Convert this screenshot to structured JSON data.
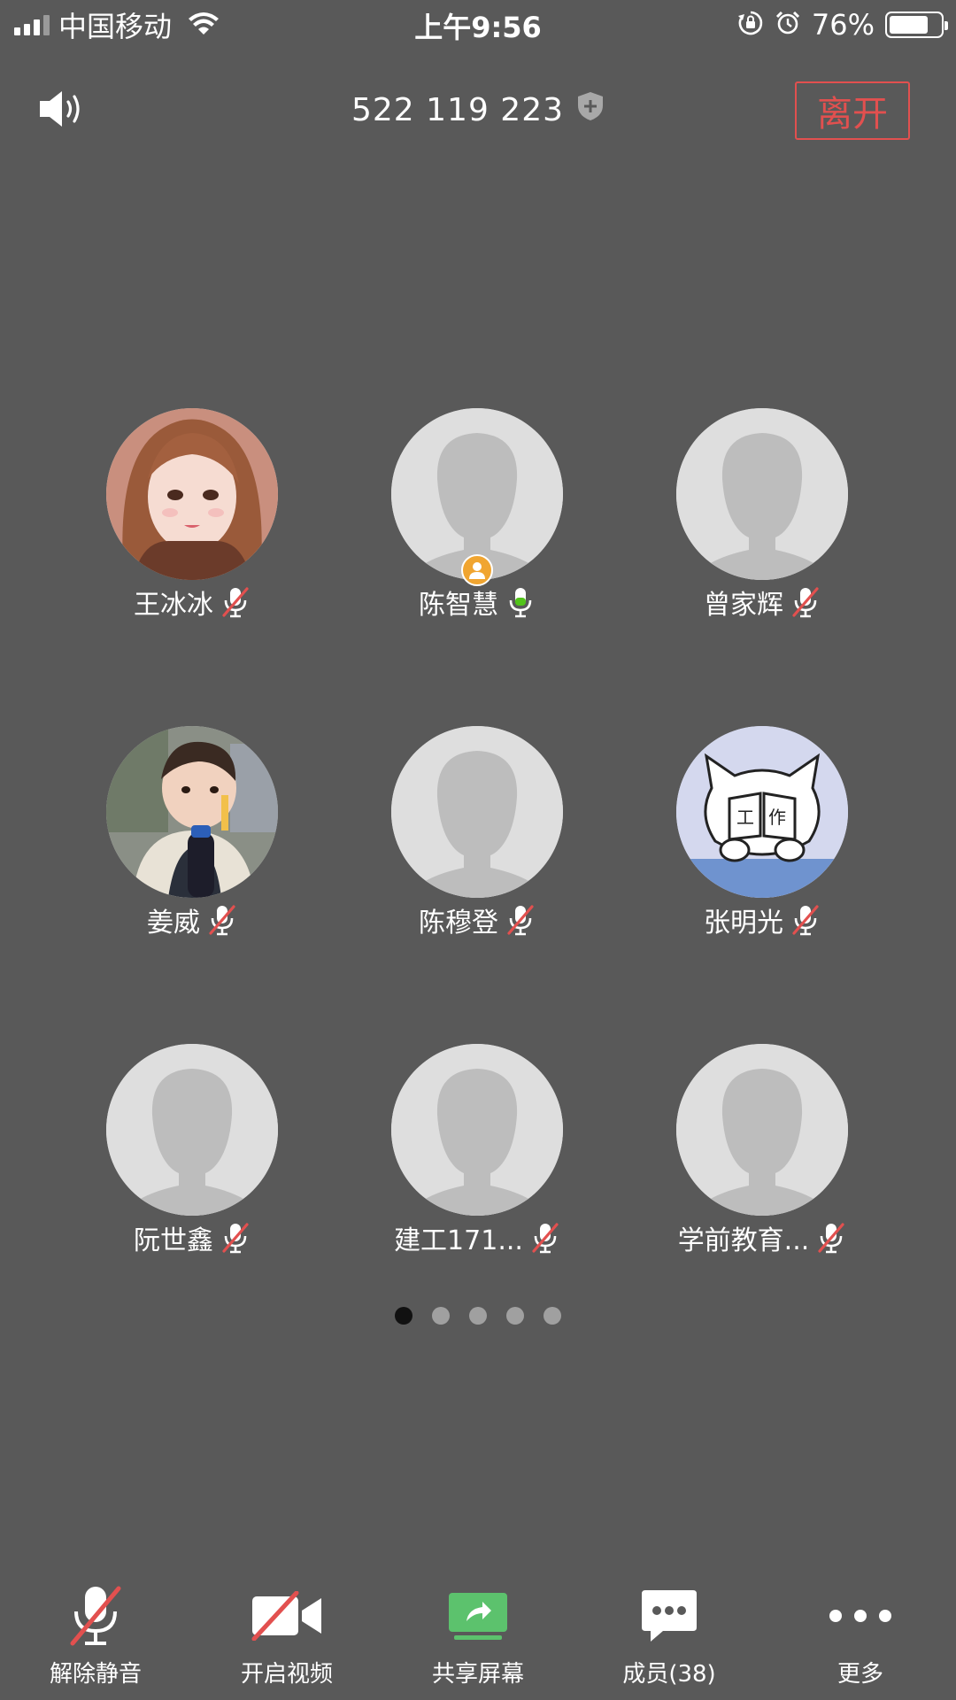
{
  "status_bar": {
    "carrier": "中国移动",
    "time": "上午9:56",
    "battery_percent": "76%",
    "battery_level": 0.76
  },
  "header": {
    "meeting_id": "522 119 223",
    "leave_label": "离开"
  },
  "participants": [
    {
      "name": "王冰冰",
      "mic": "muted",
      "avatar": "photo-girl-icon"
    },
    {
      "name": "陈智慧",
      "mic": "active",
      "avatar": "default-avatar-icon",
      "host": true
    },
    {
      "name": "曾家辉",
      "mic": "muted",
      "avatar": "default-avatar-icon"
    },
    {
      "name": "姜威",
      "mic": "muted",
      "avatar": "photo-child-icon"
    },
    {
      "name": "陈穆登",
      "mic": "muted",
      "avatar": "default-avatar-icon"
    },
    {
      "name": "张明光",
      "mic": "muted",
      "avatar": "cartoon-cat-icon"
    },
    {
      "name": "阮世鑫",
      "mic": "muted",
      "avatar": "default-avatar-icon"
    },
    {
      "name": "建工171...",
      "mic": "muted",
      "avatar": "default-avatar-icon"
    },
    {
      "name": "学前教育...",
      "mic": "muted",
      "avatar": "default-avatar-icon"
    }
  ],
  "pagination": {
    "pages": 5,
    "current": 1
  },
  "toolbar": {
    "unmute_label": "解除静音",
    "video_label": "开启视频",
    "share_label": "共享屏幕",
    "members_label": "成员(38)",
    "more_label": "更多"
  },
  "colors": {
    "background": "#595959",
    "leave": "#e2504f",
    "host_badge": "#f0a531",
    "share_green": "#5cc26d",
    "mic_active_green": "#52c41a",
    "mute_slash": "#e2504f"
  }
}
